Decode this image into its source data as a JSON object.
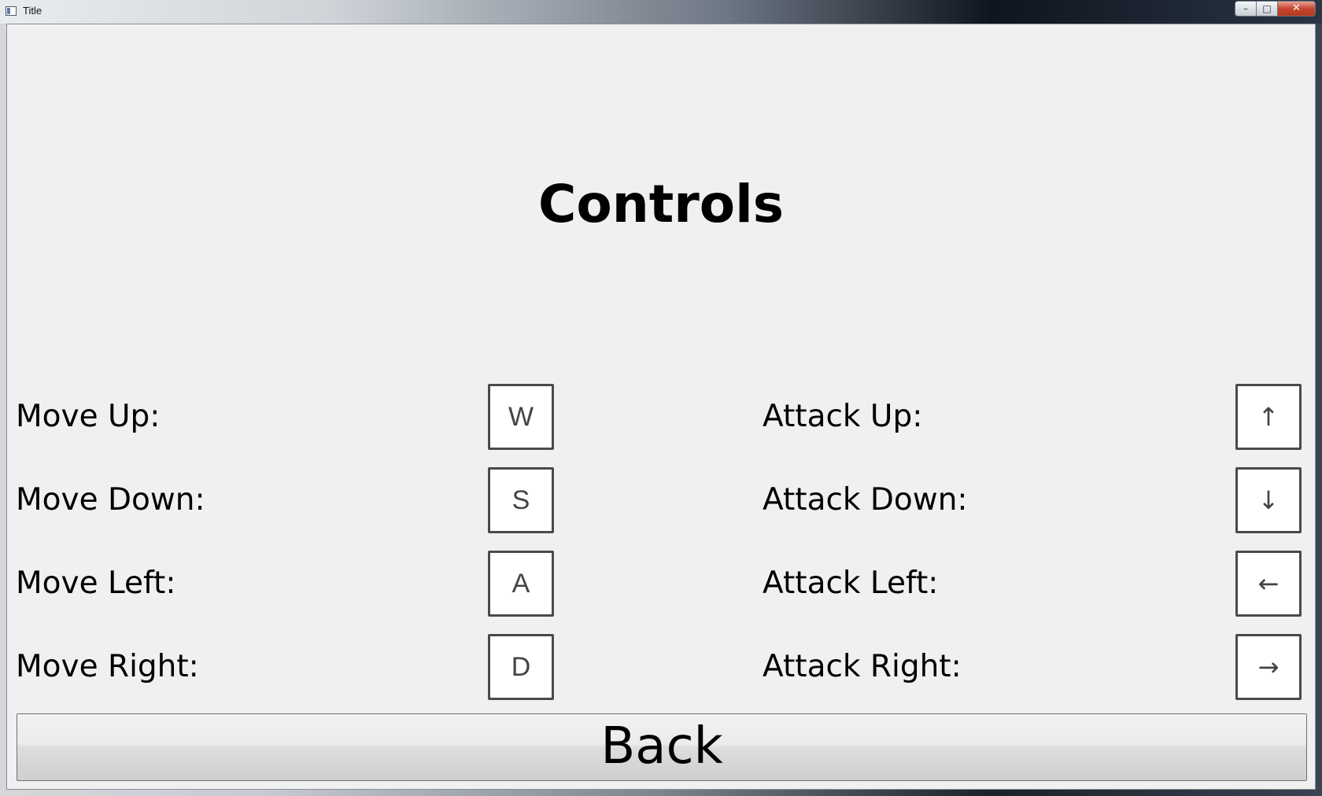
{
  "window": {
    "title": "Title",
    "controls": {
      "minimize": "–",
      "maximize": "□",
      "close": "✕"
    }
  },
  "page": {
    "heading": "Controls"
  },
  "movement": [
    {
      "label": "Move Up:",
      "key": "W"
    },
    {
      "label": "Move Down:",
      "key": "S"
    },
    {
      "label": "Move Left:",
      "key": "A"
    },
    {
      "label": "Move Right:",
      "key": "D"
    }
  ],
  "attack": [
    {
      "label": "Attack Up:",
      "key": "↑"
    },
    {
      "label": "Attack Down:",
      "key": "↓"
    },
    {
      "label": "Attack Left:",
      "key": "←"
    },
    {
      "label": "Attack Right:",
      "key": "→"
    }
  ],
  "back_button": {
    "label": "Back"
  }
}
